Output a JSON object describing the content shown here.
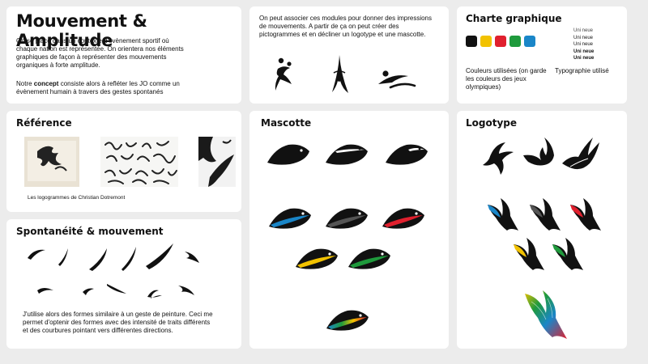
{
  "intro": {
    "title": "Mouvement & Amplitude",
    "p1": "On se place dans un contexte d'évènement sportif où chaque nation est représentée. On orientera nos éléments graphiques de façon à représenter des mouvements organiques à forte amplitude.",
    "p2_before": "Notre ",
    "p2_bold": "concept",
    "p2_after": " consiste alors à refléter les JO comme un évènement humain à travers des gestes spontanés"
  },
  "modules": {
    "text": "On peut associer ces modules pour donner des impressions de mouvements. A partir de ça on peut créer des pictogrammes et en décliner un logotype et une mascotte."
  },
  "charte": {
    "title": "Charte graphique",
    "colors": [
      "#111111",
      "#f2c200",
      "#e0202e",
      "#1f9a3c",
      "#1a86c8"
    ],
    "colors_caption": "Couleurs utilisées (on garde les couleurs des jeux olympiques)",
    "typo_samples": [
      "Uni neue",
      "Uni neue",
      "Uni neue",
      "Uni neue",
      "Uni neue"
    ],
    "typo_caption": "Typographie utilisé"
  },
  "reference": {
    "title": "Référence",
    "caption": "Les logogrammes de Christian Dotremont"
  },
  "spontaneite": {
    "title": "Spontanéité & mouvement",
    "text": "J'utilise alors des formes similaire à un geste de peinture. Ceci me permet d'optenir des formes avec des intensité de traits différents et des courbures pointant vers différentes directions."
  },
  "mascotte": {
    "title": "Mascotte",
    "stripe_colors": [
      "#1a86c8",
      "#555555",
      "#e0202e",
      "#f2c200",
      "#1f9a3c"
    ]
  },
  "logotype": {
    "title": "Logotype",
    "wing_colors": [
      "#1a86c8",
      "#555555",
      "#e0202e",
      "#f2c200",
      "#1f9a3c"
    ]
  }
}
